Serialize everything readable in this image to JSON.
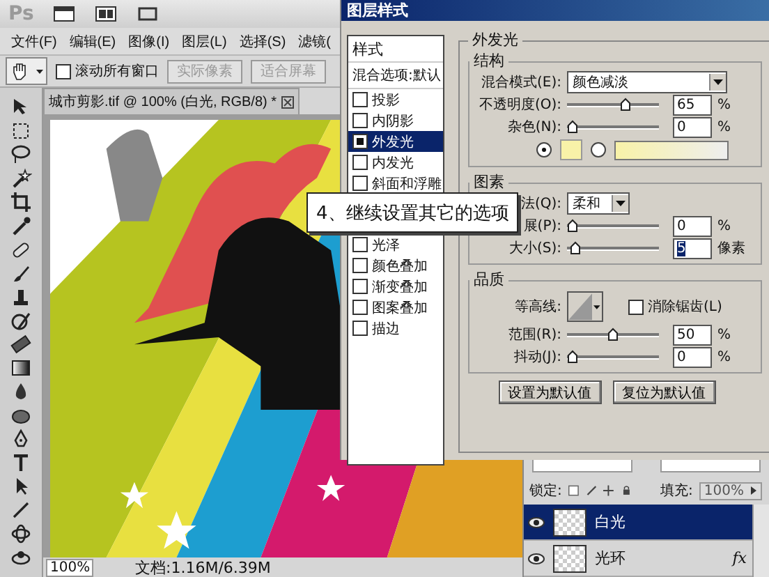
{
  "app_bar": {
    "logo": "Ps"
  },
  "menu": [
    "文件(F)",
    "编辑(E)",
    "图像(I)",
    "图层(L)",
    "选择(S)",
    "滤镜("
  ],
  "options_bar": {
    "scroll_all": {
      "label": "滚动所有窗口",
      "checked": false
    },
    "buttons": [
      {
        "label": "实际像素",
        "disabled": true
      },
      {
        "label": "适合屏幕",
        "disabled": true
      }
    ]
  },
  "document": {
    "tab_title": "城市剪影.tif @ 100% (白光, RGB/8) *",
    "zoom": "100%",
    "doc_info": "文档:1.16M/6.39M"
  },
  "callout": "4、继续设置其它的选项",
  "dialog": {
    "title": "图层样式",
    "styles_header": "样式",
    "blend_options": "混合选项:默认",
    "effects": [
      {
        "label": "投影",
        "checked": false,
        "selected": false
      },
      {
        "label": "内阴影",
        "checked": false,
        "selected": false
      },
      {
        "label": "外发光",
        "checked": true,
        "selected": true
      },
      {
        "label": "内发光",
        "checked": false,
        "selected": false
      },
      {
        "label": "斜面和浮雕",
        "checked": false,
        "selected": false
      },
      {
        "label": "光泽",
        "checked": false,
        "selected": false,
        "gap_before": true
      },
      {
        "label": "颜色叠加",
        "checked": false,
        "selected": false
      },
      {
        "label": "渐变叠加",
        "checked": false,
        "selected": false
      },
      {
        "label": "图案叠加",
        "checked": false,
        "selected": false
      },
      {
        "label": "描边",
        "checked": false,
        "selected": false
      }
    ],
    "panel_title": "外发光",
    "sections": [
      {
        "title": "结构",
        "rows": [
          {
            "kind": "select",
            "label": "混合模式(E):",
            "value": "颜色减淡"
          },
          {
            "kind": "slider",
            "label": "不透明度(O):",
            "level": 0.65,
            "value": "65",
            "unit": "%"
          },
          {
            "kind": "slider",
            "label": "杂色(N):",
            "level": 0,
            "value": "0",
            "unit": "%"
          },
          {
            "kind": "fill",
            "options": [
              {
                "kind": "color",
                "selected": true
              },
              {
                "kind": "gradient",
                "selected": false
              }
            ]
          }
        ]
      },
      {
        "title": "图素",
        "rows": [
          {
            "kind": "short-select",
            "label": "法(Q):",
            "value": "柔和"
          },
          {
            "kind": "slider",
            "label": "展(P):",
            "level": 0,
            "value": "0",
            "unit": "%"
          },
          {
            "kind": "slider",
            "label": "大小(S):",
            "level": 0.04,
            "value": "5",
            "unit": "像素",
            "highlighted": true
          }
        ]
      },
      {
        "title": "品质",
        "rows": [
          {
            "kind": "contour",
            "label": "等高线:",
            "checkbox": {
              "label": "消除锯齿(L)",
              "checked": false
            }
          },
          {
            "kind": "slider",
            "label": "范围(R):",
            "level": 0.5,
            "value": "50",
            "unit": "%"
          },
          {
            "kind": "slider",
            "label": "抖动(J):",
            "level": 0,
            "value": "0",
            "unit": "%"
          }
        ]
      }
    ],
    "buttons": [
      "设置为默认值",
      "复位为默认值"
    ]
  },
  "layers_panel": {
    "lock_label": "锁定:",
    "fill_label": "填充:",
    "fill_value": "100%",
    "layers": [
      {
        "name": "白光",
        "selected": true,
        "visible": true
      },
      {
        "name": "光环",
        "selected": false,
        "visible": true,
        "effects_badge": "fx"
      }
    ]
  }
}
